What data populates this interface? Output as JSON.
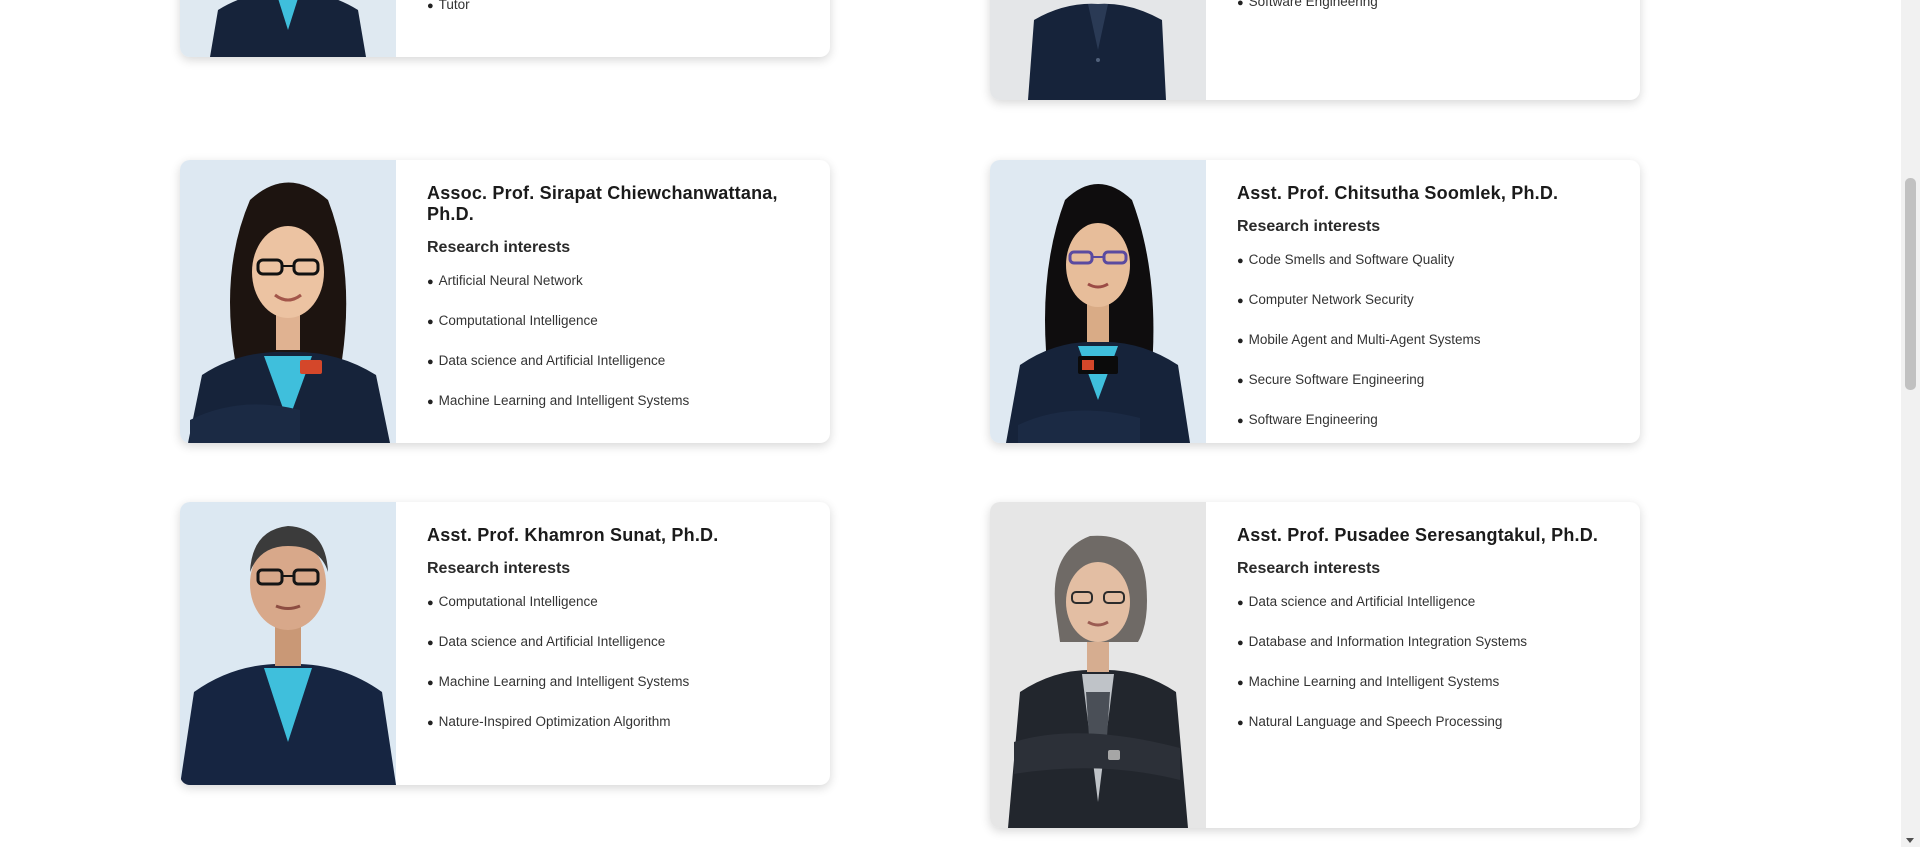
{
  "profiles": [
    {
      "name": "",
      "research_label": "",
      "interests": [
        "Tutor"
      ]
    },
    {
      "name": "",
      "research_label": "",
      "interests": [
        "Software Engineering"
      ]
    },
    {
      "name": "Assoc. Prof. Sirapat Chiewchanwattana, Ph.D.",
      "research_label": "Research interests",
      "interests": [
        "Artificial Neural Network",
        "Computational Intelligence",
        "Data science and Artificial Intelligence",
        "Machine Learning and Intelligent Systems"
      ]
    },
    {
      "name": "Asst. Prof. Chitsutha Soomlek, Ph.D.",
      "research_label": "Research interests",
      "interests": [
        "Code Smells and Software Quality",
        "Computer Network Security",
        "Mobile Agent and Multi-Agent Systems",
        "Secure Software Engineering",
        "Software Engineering"
      ]
    },
    {
      "name": "Asst. Prof. Khamron Sunat, Ph.D.",
      "research_label": "Research interests",
      "interests": [
        "Computational Intelligence",
        "Data science and Artificial Intelligence",
        "Machine Learning and Intelligent Systems",
        "Nature-Inspired Optimization Algorithm"
      ]
    },
    {
      "name": "Asst. Prof. Pusadee Seresangtakul, Ph.D.",
      "research_label": "Research interests",
      "interests": [
        "Data science and Artificial Intelligence",
        "Database and Information Integration Systems",
        "Machine Learning and Intelligent Systems",
        "Natural Language and Speech Processing"
      ]
    }
  ],
  "colors": {
    "accent_shirt": "#3fbfdc",
    "blazer": "#16233a",
    "photo_bg_cool": "#dde8f2",
    "photo_bg_grey": "#e6e6e6"
  }
}
